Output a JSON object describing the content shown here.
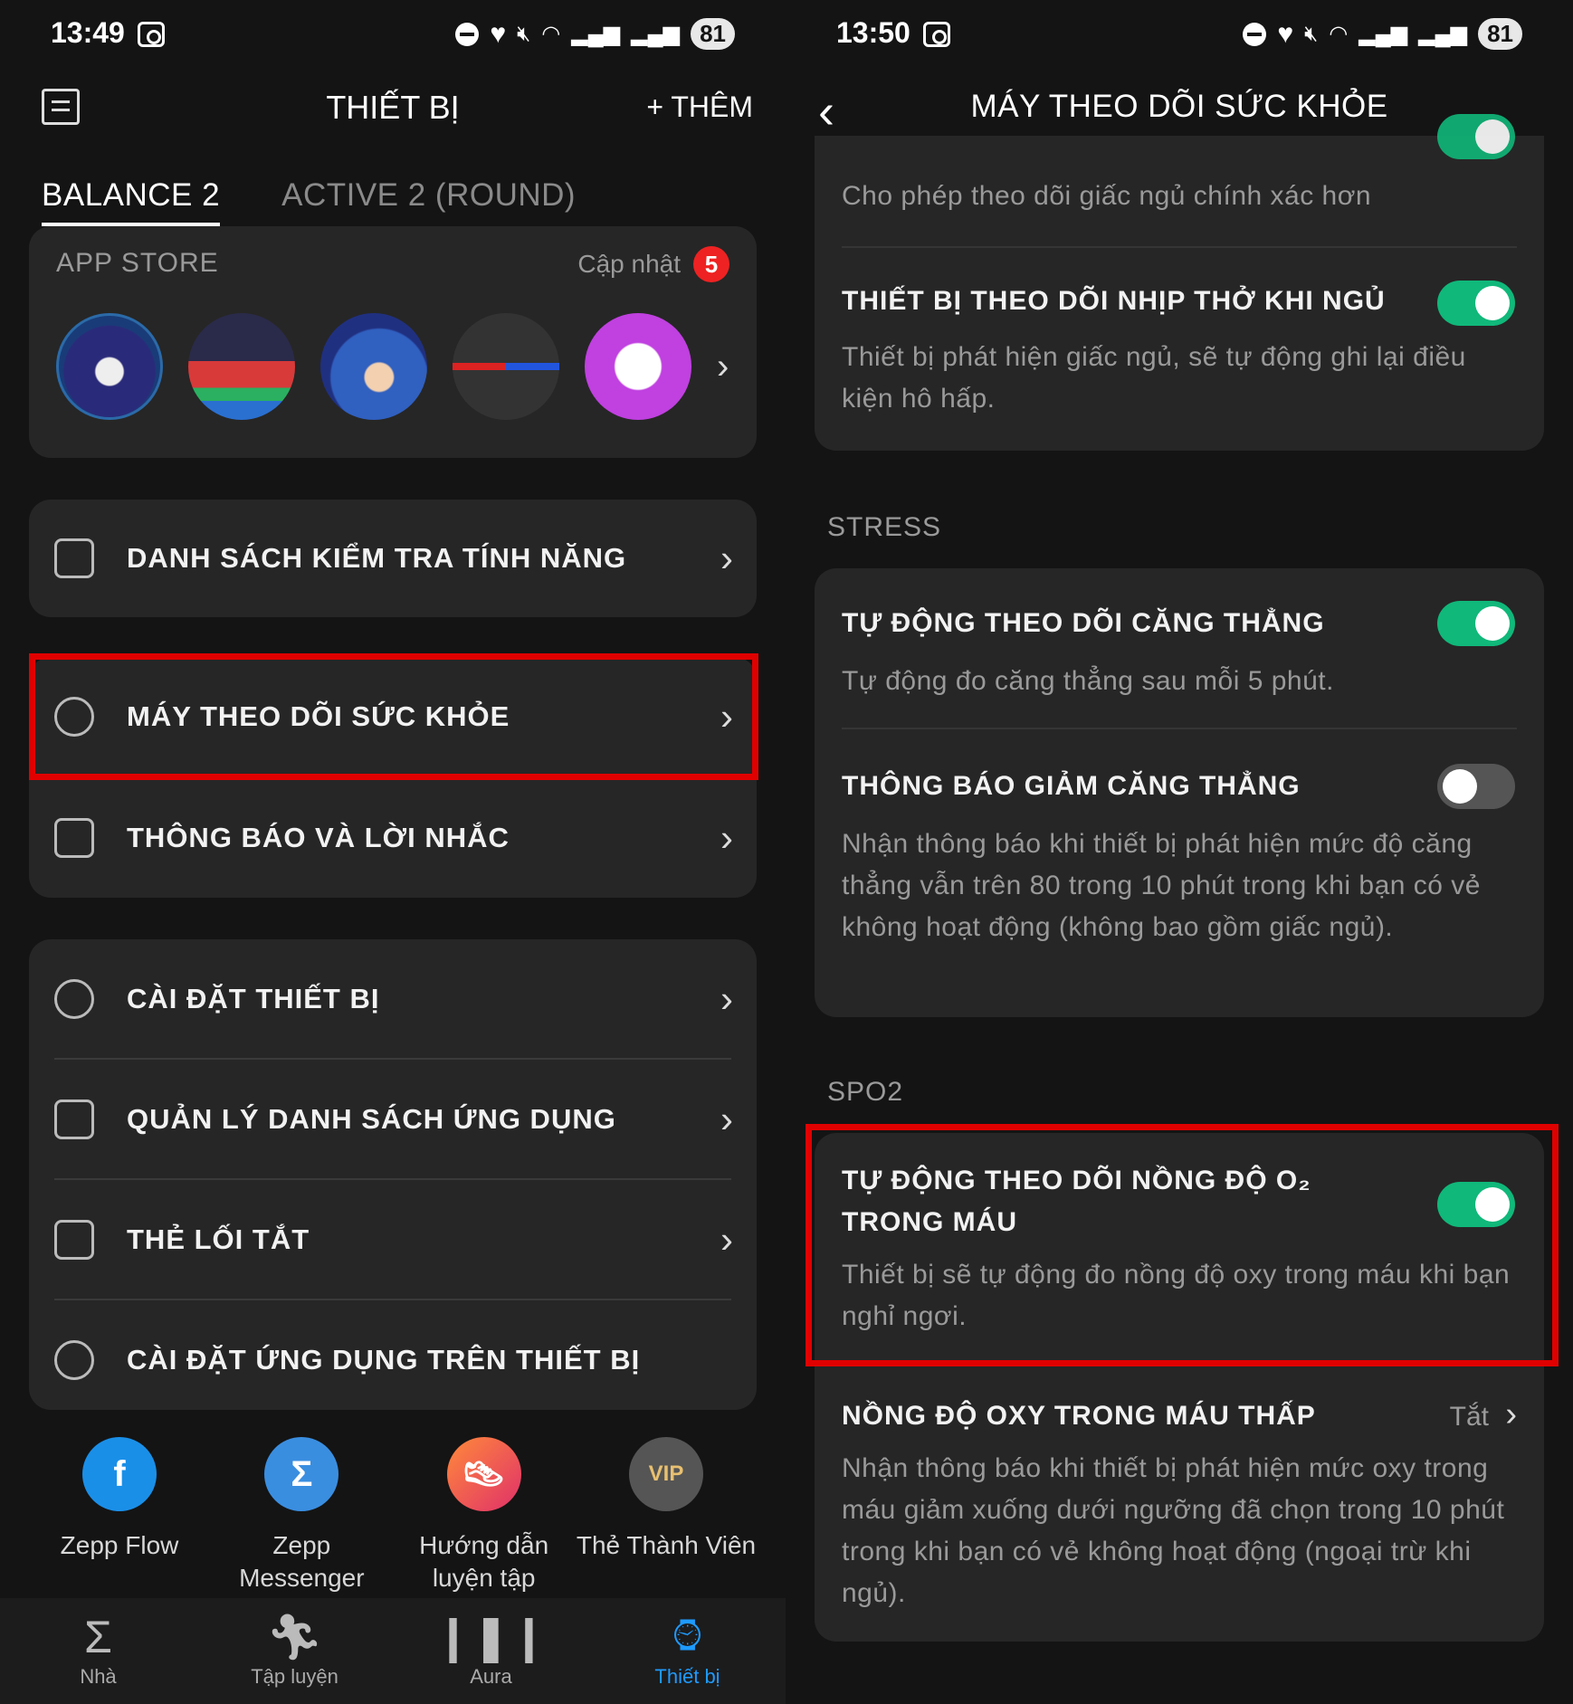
{
  "left": {
    "status": {
      "time": "13:49",
      "battery": "81"
    },
    "header": {
      "title": "THIẾT BỊ",
      "add": "+ THÊM"
    },
    "tabs": [
      "BALANCE 2",
      "ACTIVE 2 (ROUND)"
    ],
    "appstore": {
      "label": "APP STORE",
      "update_label": "Cập nhật",
      "update_count": "5"
    },
    "menu": {
      "checklist": "DANH SÁCH KIỂM TRA TÍNH NĂNG",
      "health_monitor": "MÁY THEO DÕI SỨC KHỎE",
      "notifications": "THÔNG BÁO VÀ LỜI NHẮC",
      "device_settings": "CÀI ĐẶT THIẾT BỊ",
      "app_list": "QUẢN LÝ DANH SÁCH ỨNG DỤNG",
      "shortcut_cards": "THẺ LỐI TẮT",
      "app_settings": "CÀI ĐẶT ỨNG DỤNG TRÊN THIẾT BỊ"
    },
    "shortcuts": [
      "Zepp Flow",
      "Zepp Messenger",
      "Hướng dẫn luyện tập",
      "Thẻ Thành Viên"
    ],
    "nav": [
      "Nhà",
      "Tập luyện",
      "Aura",
      "Thiết bị"
    ]
  },
  "right": {
    "status": {
      "time": "13:50",
      "battery": "81"
    },
    "header": {
      "title": "MÁY THEO DÕI SỨC KHỎE"
    },
    "sleep_desc": "Cho phép theo dõi giấc ngủ chính xác hơn",
    "sleep_breathing": {
      "title": "THIẾT BỊ THEO DÕI NHỊP THỞ KHI NGỦ",
      "desc": "Thiết bị phát hiện giấc ngủ, sẽ tự động ghi lại điều kiện hô hấp.",
      "on": true
    },
    "stress_section": "STRESS",
    "auto_stress": {
      "title": "TỰ ĐỘNG THEO DÕI CĂNG THẲNG",
      "desc": "Tự động đo căng thẳng sau mỗi 5 phút.",
      "on": true
    },
    "relax_alert": {
      "title": "THÔNG BÁO GIẢM CĂNG THẲNG",
      "desc": "Nhận thông báo khi thiết bị phát hiện mức độ căng thẳng vẫn trên 80 trong 10 phút trong khi bạn có vẻ không hoạt động (không bao gồm giấc ngủ).",
      "on": false
    },
    "spo2_section": "SPO2",
    "auto_spo2": {
      "title_line1": "TỰ ĐỘNG THEO DÕI NỒNG ĐỘ O₂",
      "title_line2": "TRONG MÁU",
      "desc": "Thiết bị sẽ tự động đo nồng độ oxy trong máu khi bạn nghỉ ngơi.",
      "on": true
    },
    "low_spo2": {
      "title": "NỒNG ĐỘ OXY TRONG MÁU THẤP",
      "value": "Tắt",
      "desc": "Nhận thông báo khi thiết bị phát hiện mức oxy trong máu giảm xuống dưới ngưỡng đã chọn trong 10 phút trong khi bạn có vẻ không hoạt động (ngoại trừ khi ngủ)."
    }
  },
  "colors": {
    "accent_green": "#10b87a",
    "highlight_red": "#e00000",
    "nav_active": "#1e9bff"
  }
}
